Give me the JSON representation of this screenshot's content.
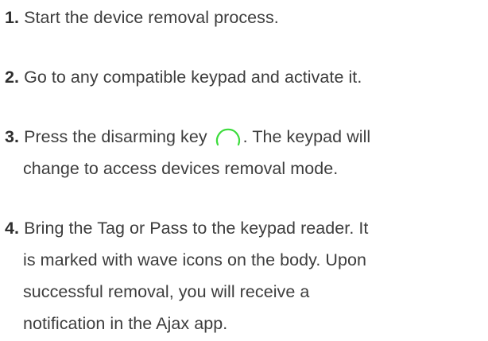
{
  "steps": [
    {
      "number": "1.",
      "lines": [
        "Start the device removal process."
      ]
    },
    {
      "number": "2.",
      "lines": [
        "Go to any compatible keypad and activate it."
      ]
    },
    {
      "number": "3.",
      "before_icon": "Press the disarming key",
      "icon": "disarm-key-icon",
      "after_icon": ". The keypad will",
      "lines": [
        "change to access devices removal mode."
      ]
    },
    {
      "number": "4.",
      "lines": [
        "Bring the Tag or Pass to the keypad reader. It",
        "is marked with wave icons on the body. Upon",
        "successful removal, you will receive a",
        "notification in the Ajax app."
      ]
    }
  ],
  "colors": {
    "text": "#3d3d3d",
    "icon_outline": "#3ddc3d"
  }
}
